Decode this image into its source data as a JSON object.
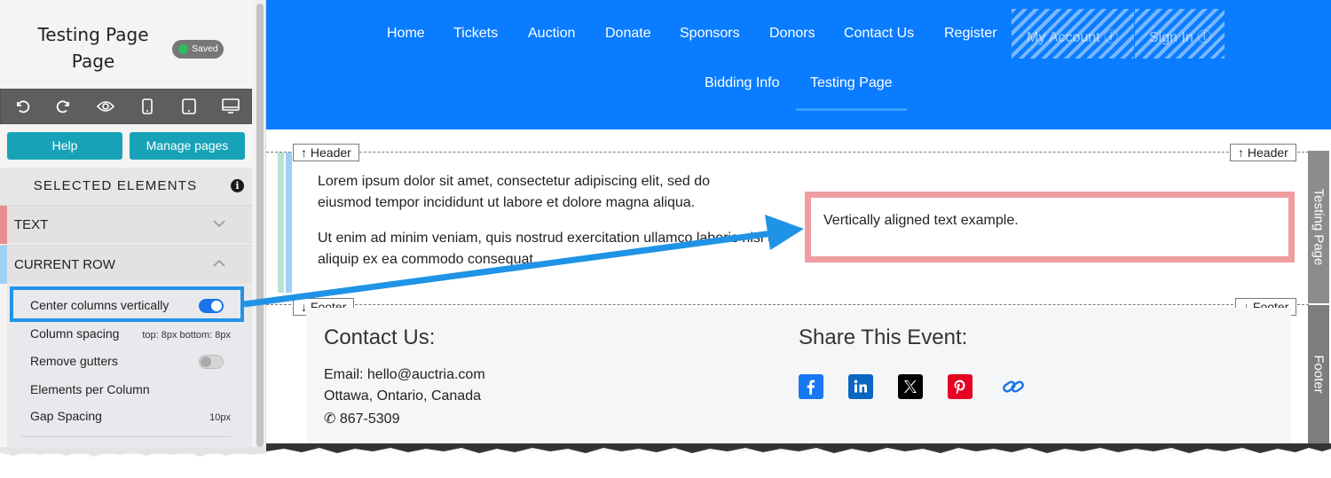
{
  "sidebar": {
    "title": "Testing Page\nPage",
    "saved_badge": "Saved",
    "toolbar_icons": [
      "undo-icon",
      "redo-icon",
      "eye-icon",
      "phone-icon",
      "tablet-icon",
      "desktop-icon"
    ],
    "help_label": "Help",
    "manage_pages_label": "Manage pages",
    "selected_elements_label": "SELECTED ELEMENTS",
    "sections": [
      {
        "label": "TEXT",
        "expanded": false,
        "accent": "#e88d8f"
      },
      {
        "label": "CURRENT ROW",
        "expanded": true,
        "accent": "#9ed0f5"
      }
    ],
    "options": {
      "center_columns_vertically": {
        "label": "Center columns vertically",
        "on": true
      },
      "column_spacing": {
        "label": "Column spacing",
        "value": "top: 8px bottom: 8px"
      },
      "remove_gutters": {
        "label": "Remove gutters",
        "on": false
      },
      "elements_per_column": {
        "label": "Elements per Column"
      },
      "gap_spacing": {
        "label": "Gap Spacing",
        "value": "10px"
      }
    }
  },
  "nav": {
    "items": [
      "Home",
      "Tickets",
      "Auction",
      "Donate",
      "Sponsors",
      "Donors",
      "Contact Us",
      "Register"
    ],
    "my_account": "My Account",
    "sign_in": "Sign In",
    "row2": [
      "Bidding Info",
      "Testing Page"
    ],
    "active": "Testing Page",
    "bg_color": "#0a7cff"
  },
  "content": {
    "header_tag": "Header",
    "footer_tag": "Footer",
    "side_tab_page": "Testing Page",
    "side_tab_footer": "Footer",
    "para1": "Lorem ipsum dolor sit amet, consectetur adipiscing elit, sed do eiusmod tempor incididunt ut labore et dolore magna aliqua.",
    "para2": "Ut enim ad minim veniam, quis nostrud exercitation ullamco laboris nisi ut aliquip ex ea commodo consequat.",
    "vertical_box_text": "Vertically aligned text example."
  },
  "footer": {
    "contact_heading": "Contact Us:",
    "email": "Email: hello@auctria.com",
    "location": "Ottawa, Ontario, Canada",
    "phone": "867-5309",
    "share_heading": "Share This Event:",
    "social_icons": [
      "facebook-icon",
      "linkedin-icon",
      "x-icon",
      "pinterest-icon",
      "link-icon"
    ]
  },
  "colors": {
    "accent_teal": "#18a2b8",
    "highlight_blue": "#1f93e6",
    "pink_border": "#f09ea1"
  }
}
